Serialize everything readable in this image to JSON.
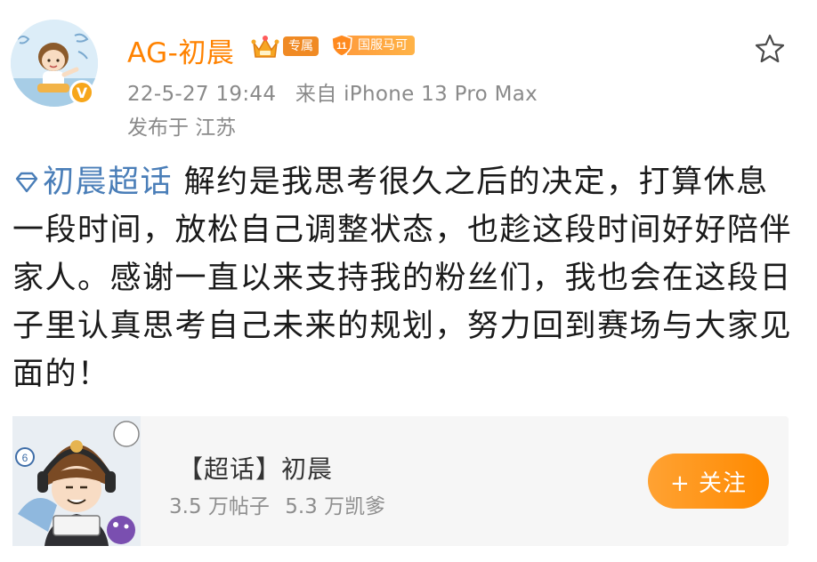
{
  "post": {
    "author": {
      "name": "AG-初晨",
      "exclusive_tag": "专属",
      "level_badge_text": "国服马可",
      "level_number": "11",
      "verified_mark": "V"
    },
    "meta": {
      "timestamp": "22-5-27 19:44",
      "source": "来自 iPhone 13 Pro Max",
      "location": "发布于 江苏"
    },
    "topic_link": "初晨超话",
    "body_text": " 解约是我思考很久之后的决定，打算休息一段时间，放松自己调整状态，也趁这段时间好好陪伴家人。感谢一直以来支持我的粉丝们，我也会在这段日子里认真思考自己未来的规划，努力回到赛场与大家见面的！"
  },
  "supertopic_card": {
    "title": "【超话】初晨",
    "posts_count": "3.5 万帖子",
    "followers_count": "5.3 万凯爹",
    "follow_button_label": "+ 关注"
  },
  "colors": {
    "accent_orange": "#ff8200",
    "link_blue": "#4a7eb8",
    "meta_gray": "#8a8a8a"
  },
  "icons": [
    "star-icon",
    "crown-icon",
    "level-shield-icon",
    "supertopic-diamond-icon",
    "verified-icon"
  ]
}
